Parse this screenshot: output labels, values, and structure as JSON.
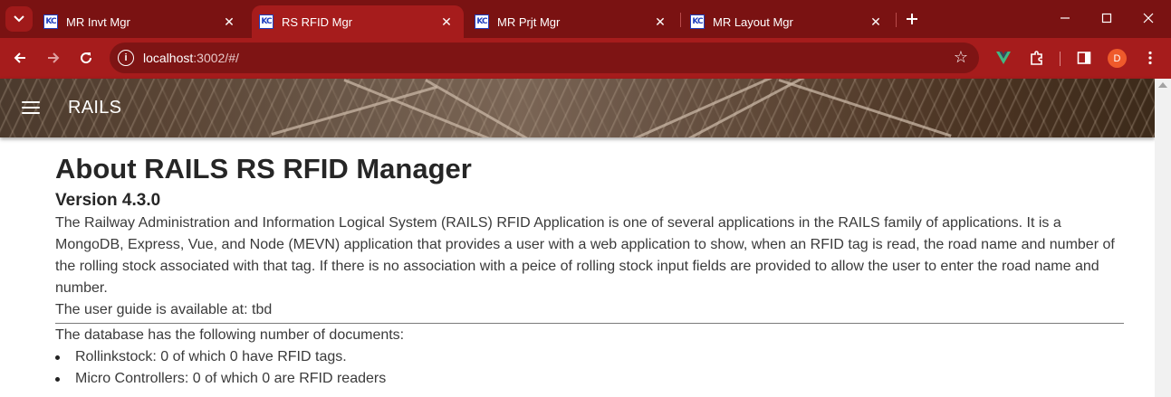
{
  "browser": {
    "tabs": [
      {
        "title": "MR Invt Mgr",
        "favicon": "KC",
        "active": false
      },
      {
        "title": "RS RFID Mgr",
        "favicon": "KC",
        "active": true
      },
      {
        "title": "MR Prjt Mgr",
        "favicon": "KC",
        "active": false
      },
      {
        "title": "MR Layout Mgr",
        "favicon": "KC",
        "active": false
      }
    ],
    "url_host": "localhost",
    "url_path": ":3002/#/",
    "profile_initial": "D",
    "colors": {
      "tabstrip": "#7a1212",
      "toolbar": "#a61c1c",
      "omnibox": "#7e1414",
      "profile": "#ef5a2b"
    }
  },
  "appbar": {
    "title": "RAILS"
  },
  "about": {
    "heading": "About RAILS RS RFID Manager",
    "version": "Version 4.3.0",
    "description": "The Railway Administration and Information Logical System (RAILS) RFID Application is one of several applications in the RAILS family of applications. It is a MongoDB, Express, Vue, and Node (MEVN) application that provides a user with a web application to show, when an RFID tag is read, the road name and number of the rolling stock associated with that tag. If there is no association with a peice of rolling stock input fields are provided to allow the user to enter the road name and number.",
    "user_guide": "The user guide is available at: tbd",
    "db_intro": "The database has the following number of documents:",
    "db_items": [
      "Rollinkstock: 0 of which 0 have RFID tags.",
      "Micro Controllers: 0 of which 0 are RFID readers"
    ]
  }
}
